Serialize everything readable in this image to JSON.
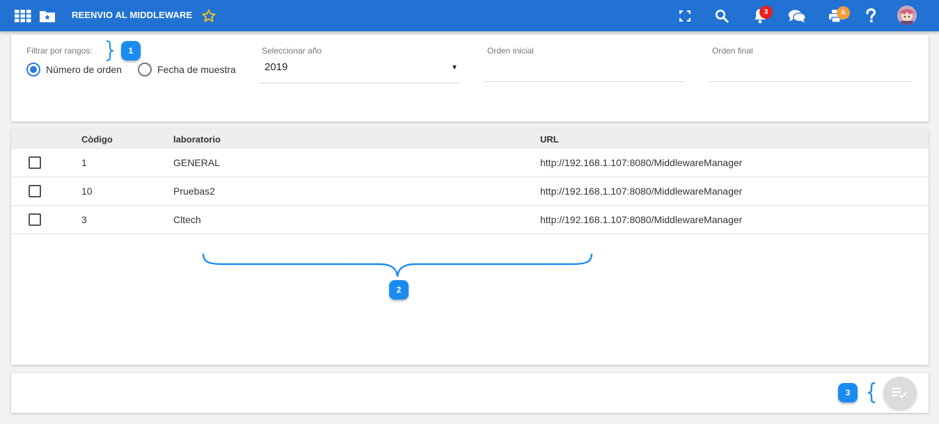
{
  "header": {
    "title": "REENVIO AL MIDDLEWARE",
    "notifications_count": "3",
    "printer_badge": "A",
    "icons": [
      "apps-grid-icon",
      "folder-star-icon",
      "star-icon",
      "fullscreen-icon",
      "search-icon",
      "bell-icon",
      "chat-icon",
      "printer-icon",
      "help-icon",
      "avatar"
    ]
  },
  "filters": {
    "range_label": "Filtrar por rangos:",
    "radio_options": [
      "Número de orden",
      "Fecha de muestra"
    ],
    "selected_option": "Número de orden",
    "year_label": "Seleccionar año",
    "year_value": "2019",
    "order_start_label": "Orden inicial",
    "order_start_value": "",
    "order_end_label": "Orden final",
    "order_end_value": ""
  },
  "table": {
    "columns": [
      "Còdigo",
      "laboratorio",
      "URL"
    ],
    "rows": [
      {
        "code": "1",
        "lab": "GENERAL",
        "url": "http://192.168.1.107:8080/MiddlewareManager"
      },
      {
        "code": "10",
        "lab": "Pruebas2",
        "url": "http://192.168.1.107:8080/MiddlewareManager"
      },
      {
        "code": "3",
        "lab": "Cltech",
        "url": "http://192.168.1.107:8080/MiddlewareManager"
      }
    ]
  },
  "annotations": [
    "1",
    "2",
    "3"
  ],
  "colors": {
    "topbar": "#2272d4",
    "accent": "#2a7be0",
    "marker": "#1a8cf0",
    "badge_red": "#e8201d",
    "badge_orange": "#f39c3c"
  }
}
